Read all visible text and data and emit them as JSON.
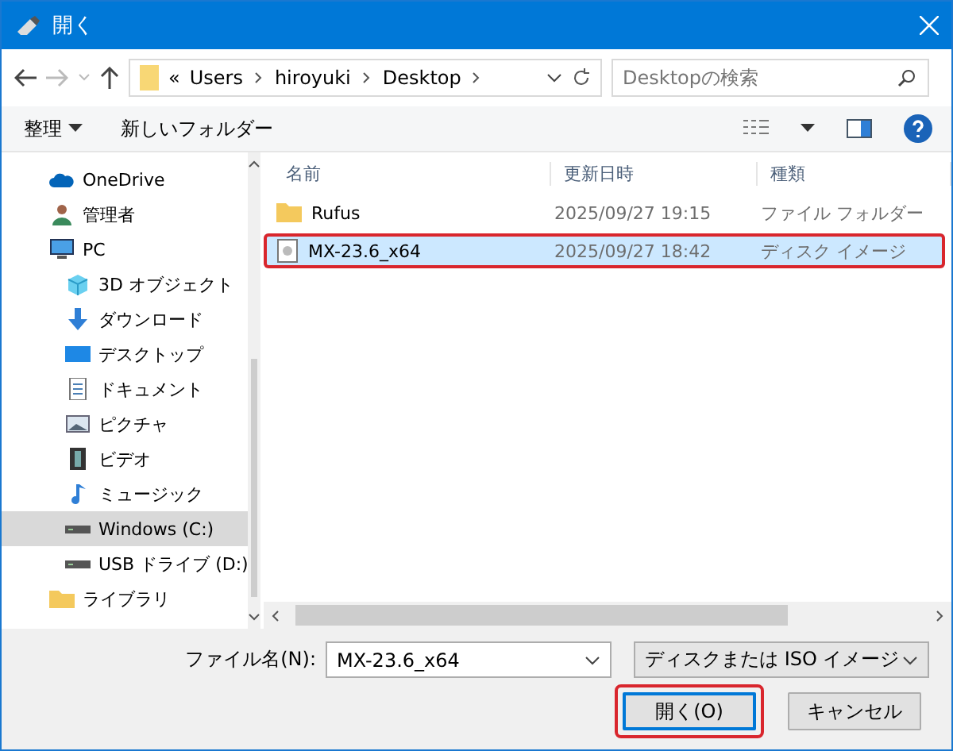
{
  "window": {
    "title": "開く"
  },
  "address": {
    "path": [
      "«",
      "Users",
      "hiroyuki",
      "Desktop"
    ]
  },
  "search": {
    "placeholder": "Desktopの検索"
  },
  "toolbar": {
    "organize": "整理",
    "new_folder": "新しいフォルダー"
  },
  "nav": [
    {
      "label": "OneDrive",
      "kind": "cloud",
      "selected": false
    },
    {
      "label": "管理者",
      "kind": "user",
      "selected": false
    },
    {
      "label": "PC",
      "kind": "pc",
      "selected": false,
      "children": [
        {
          "label": "3D オブジェクト",
          "kind": "cube",
          "selected": false
        },
        {
          "label": "ダウンロード",
          "kind": "download",
          "selected": false
        },
        {
          "label": "デスクトップ",
          "kind": "desktop",
          "selected": false
        },
        {
          "label": "ドキュメント",
          "kind": "document",
          "selected": false
        },
        {
          "label": "ピクチャ",
          "kind": "picture",
          "selected": false
        },
        {
          "label": "ビデオ",
          "kind": "video",
          "selected": false
        },
        {
          "label": "ミュージック",
          "kind": "music",
          "selected": false
        },
        {
          "label": "Windows (C:)",
          "kind": "drive",
          "selected": true
        },
        {
          "label": "USB ドライブ (D:)",
          "kind": "drive",
          "selected": false
        }
      ]
    },
    {
      "label": "ライブラリ",
      "kind": "folder",
      "selected": false
    }
  ],
  "table": {
    "columns": [
      "名前",
      "更新日時",
      "種類"
    ],
    "rows": [
      {
        "name": "Rufus",
        "date": "2025/09/27 19:15",
        "type": "ファイル フォルダー",
        "kind": "folder",
        "selected": false,
        "highlighted": false
      },
      {
        "name": "MX-23.6_x64",
        "date": "2025/09/27 18:42",
        "type": "ディスク イメージ",
        "kind": "disc",
        "selected": true,
        "highlighted": true
      }
    ]
  },
  "footer": {
    "filename_label": "ファイル名(N):",
    "filename": "MX-23.6_x64",
    "filter": "ディスクまたは ISO イメージ",
    "buttons": [
      {
        "label": "開く(O)",
        "primary": true,
        "highlighted": true
      },
      {
        "label": "キャンセル",
        "primary": false,
        "highlighted": false
      }
    ]
  }
}
